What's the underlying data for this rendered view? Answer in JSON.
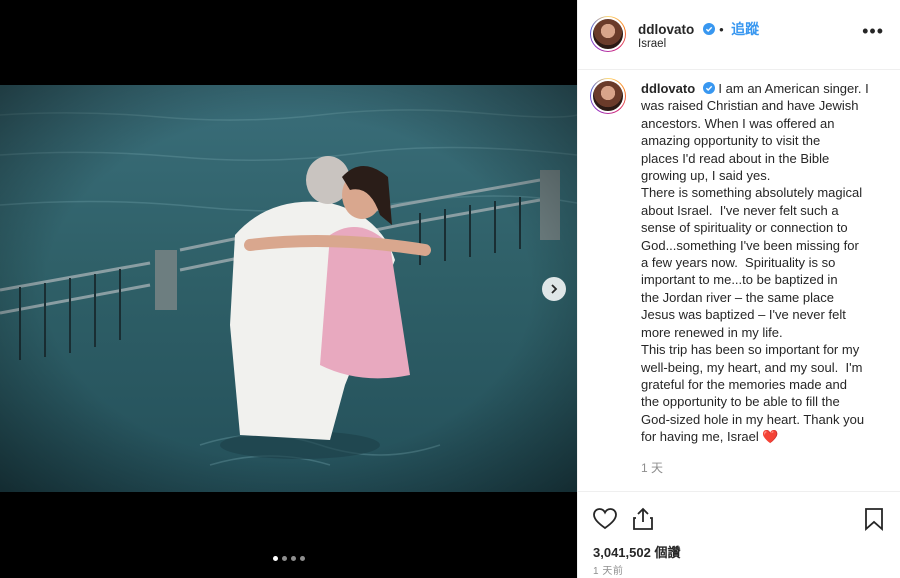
{
  "post": {
    "username": "ddlovato",
    "follow_label": "追蹤",
    "location": "Israel",
    "more_label": "•••",
    "caption_username": "ddlovato",
    "caption_lines": [
      "I am an American singer. I",
      "was raised Christian and have Jewish",
      "ancestors. When I was offered an",
      "amazing opportunity to visit the",
      "places I'd read about in the Bible",
      "growing up, I said yes.",
      "There is something absolutely magical",
      "about Israel.  I've never felt such a",
      "sense of spirituality or connection to",
      "God...something I've been missing for",
      "a few years now.  Spirituality is so",
      "important to me...to be baptized in",
      "the Jordan river – the same place",
      "Jesus was baptized – I've never felt",
      "more renewed in my life.",
      "This trip has been so important for my",
      "well-being, my heart, and my soul.  I'm",
      "grateful for the memories made and",
      "the opportunity to be able to fill the",
      "God-sized hole in my heart. Thank you",
      "for having me, Israel"
    ],
    "caption_emoji": "❤️",
    "caption_time": "1 天",
    "likes": "3,041,502 個讚",
    "date": "1 天前",
    "carousel": {
      "count": 4,
      "active_index": 0
    }
  },
  "icons": {
    "verified": "verified-badge-icon",
    "like": "heart-outline-icon",
    "share": "share-icon",
    "save": "bookmark-icon",
    "next": "chevron-right-icon"
  },
  "colors": {
    "accent_blue": "#3897f0",
    "verified_blue": "#3897f0",
    "muted": "#8e8e8e",
    "heart_red": "#e0245e"
  }
}
